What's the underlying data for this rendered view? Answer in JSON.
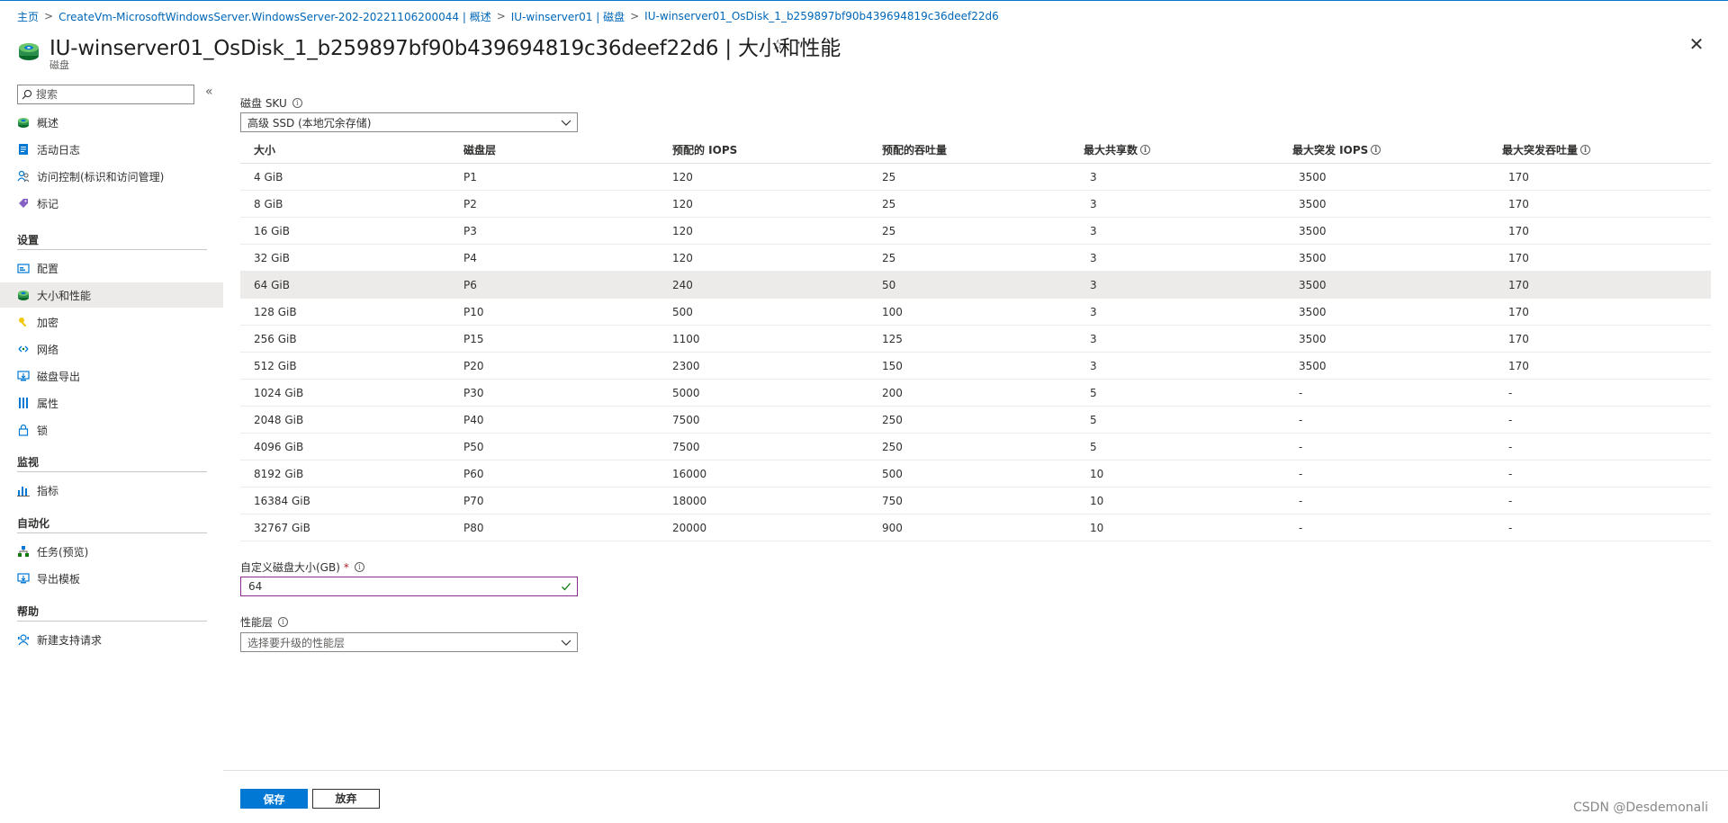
{
  "breadcrumb": [
    "主页",
    "CreateVm-MicrosoftWindowsServer.WindowsServer-202-20221106200044 | 概述",
    "IU-winserver01 | 磁盘",
    "IU-winserver01_OsDisk_1_b259897bf90b439694819c36deef22d6"
  ],
  "header": {
    "title": "IU-winserver01_OsDisk_1_b259897bf90b439694819c36deef22d6 | 大小和性能",
    "subtitle": "磁盘",
    "favorite_icon": "star-icon",
    "more_icon": "ellipsis-icon",
    "close_icon": "close-icon"
  },
  "sidebar": {
    "search_placeholder": "搜索",
    "collapse_label": "«",
    "items_top": [
      {
        "label": "概述",
        "icon": "disk-icon"
      },
      {
        "label": "活动日志",
        "icon": "activity-log-icon"
      },
      {
        "label": "访问控制(标识和访问管理)",
        "icon": "people-icon"
      },
      {
        "label": "标记",
        "icon": "tag-icon"
      }
    ],
    "sections": [
      {
        "title": "设置",
        "items": [
          {
            "label": "配置",
            "icon": "config-icon"
          },
          {
            "label": "大小和性能",
            "icon": "disk-icon",
            "active": true
          },
          {
            "label": "加密",
            "icon": "key-icon"
          },
          {
            "label": "网络",
            "icon": "network-icon"
          },
          {
            "label": "磁盘导出",
            "icon": "export-icon"
          },
          {
            "label": "属性",
            "icon": "properties-icon"
          },
          {
            "label": "锁",
            "icon": "lock-icon"
          }
        ]
      },
      {
        "title": "监视",
        "items": [
          {
            "label": "指标",
            "icon": "metrics-icon"
          }
        ]
      },
      {
        "title": "自动化",
        "items": [
          {
            "label": "任务(预览)",
            "icon": "tasks-icon"
          },
          {
            "label": "导出模板",
            "icon": "template-icon"
          }
        ]
      },
      {
        "title": "帮助",
        "items": [
          {
            "label": "新建支持请求",
            "icon": "support-icon"
          }
        ]
      }
    ]
  },
  "sku": {
    "label": "磁盘 SKU",
    "value": "高级 SSD (本地冗余存储)"
  },
  "table": {
    "headers": [
      "大小",
      "磁盘层",
      "预配的 IOPS",
      "预配的吞吐量",
      "最大共享数",
      "最大突发 IOPS",
      "最大突发吞吐量"
    ],
    "rows": [
      [
        "4 GiB",
        "P1",
        "120",
        "25",
        "3",
        "3500",
        "170"
      ],
      [
        "8 GiB",
        "P2",
        "120",
        "25",
        "3",
        "3500",
        "170"
      ],
      [
        "16 GiB",
        "P3",
        "120",
        "25",
        "3",
        "3500",
        "170"
      ],
      [
        "32 GiB",
        "P4",
        "120",
        "25",
        "3",
        "3500",
        "170"
      ],
      [
        "64 GiB",
        "P6",
        "240",
        "50",
        "3",
        "3500",
        "170"
      ],
      [
        "128 GiB",
        "P10",
        "500",
        "100",
        "3",
        "3500",
        "170"
      ],
      [
        "256 GiB",
        "P15",
        "1100",
        "125",
        "3",
        "3500",
        "170"
      ],
      [
        "512 GiB",
        "P20",
        "2300",
        "150",
        "3",
        "3500",
        "170"
      ],
      [
        "1024 GiB",
        "P30",
        "5000",
        "200",
        "5",
        "-",
        "-"
      ],
      [
        "2048 GiB",
        "P40",
        "7500",
        "250",
        "5",
        "-",
        "-"
      ],
      [
        "4096 GiB",
        "P50",
        "7500",
        "250",
        "5",
        "-",
        "-"
      ],
      [
        "8192 GiB",
        "P60",
        "16000",
        "500",
        "10",
        "-",
        "-"
      ],
      [
        "16384 GiB",
        "P70",
        "18000",
        "750",
        "10",
        "-",
        "-"
      ],
      [
        "32767 GiB",
        "P80",
        "20000",
        "900",
        "10",
        "-",
        "-"
      ]
    ],
    "selected_row": 4
  },
  "custom_size": {
    "label": "自定义磁盘大小(GB)",
    "required_mark": "*",
    "value": "64"
  },
  "perf_tier": {
    "label": "性能层",
    "placeholder": "选择要升级的性能层"
  },
  "footer": {
    "save_label": "保存",
    "discard_label": "放弃"
  },
  "watermark": "CSDN @Desdemonali",
  "colors": {
    "accent": "#0078d4",
    "link": "#0067b8",
    "selected_row": "#edebe9",
    "input_focus_border": "#8a2c8e",
    "valid_check": "#107c10",
    "required": "#a4262c"
  }
}
